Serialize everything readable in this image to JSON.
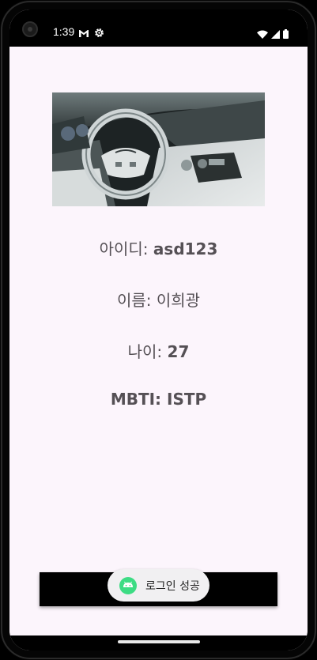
{
  "status_bar": {
    "time": "1:39",
    "left_icons": [
      "gmail-icon",
      "settings-gear-icon"
    ],
    "right_icons": [
      "wifi-icon",
      "cellular-signal-icon",
      "battery-icon"
    ]
  },
  "profile": {
    "image": {
      "icon": "car-interior-photo"
    },
    "id_label": "아이디:",
    "id_value": "asd123",
    "name_label": "이름:",
    "name_value": "이희광",
    "age_label": "나이:",
    "age_value": "27",
    "mbti_text": "MBTI: ISTP"
  },
  "bottom_button": {
    "label": ""
  },
  "toast": {
    "icon": "android-icon",
    "message": "로그인 성공"
  },
  "colors": {
    "screen_background": "#fcf5fc",
    "text": "#555055",
    "button_background": "#000000",
    "toast_background": "#f1f0f2",
    "android_green": "#3ddc84"
  }
}
